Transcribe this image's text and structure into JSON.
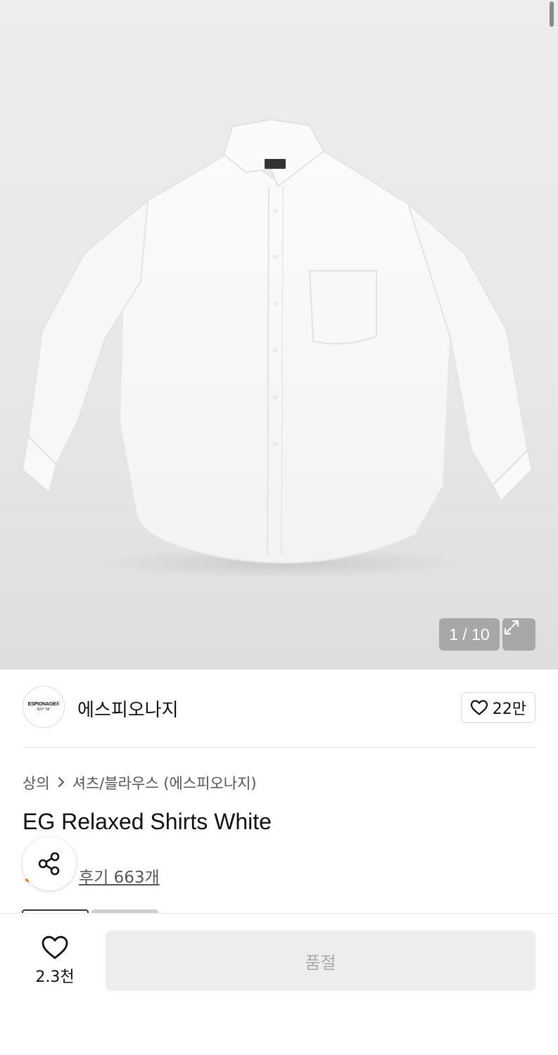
{
  "gallery": {
    "counter": "1 / 10",
    "image_alt": "white relaxed button-down shirt",
    "expand_icon": "expand-icon"
  },
  "brand": {
    "logo_line1": "ESPIONAGE®",
    "logo_line2": "N37° 56'",
    "name": "에스피오나지",
    "like_icon": "heart-outline-icon",
    "like_count": "22만"
  },
  "breadcrumb": {
    "category": "상의",
    "separator_icon": "chevron-right-icon",
    "subcategory": "셔츠/블라우스 (에스피오나지)"
  },
  "product": {
    "title": "EG Relaxed Shirts White"
  },
  "reviews": {
    "share_icon": "share-icon",
    "link_text": "후기 663개"
  },
  "bottom_bar": {
    "wish_icon": "heart-outline-icon",
    "wish_count": "2.3천",
    "buy_label": "품절"
  },
  "colors": {
    "rating_accent": "#ff7a1a",
    "soldout_bg": "#ededed",
    "soldout_text": "#aaaaaa"
  }
}
